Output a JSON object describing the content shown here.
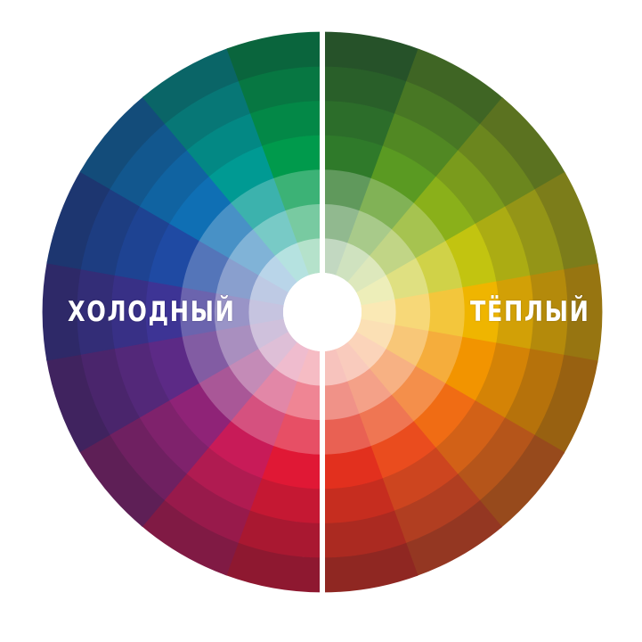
{
  "labels": {
    "cold": "ХОЛОДНЫЙ",
    "warm": "ТЁПЛЫЙ"
  },
  "wheel": {
    "background": "#ffffff",
    "center_color": "#ffffff",
    "divider_color": "#ffffff",
    "sectors": [
      {
        "side": "warm",
        "color": "#2f7a2a"
      },
      {
        "side": "warm",
        "color": "#5a9a22"
      },
      {
        "side": "warm",
        "color": "#8ab01a"
      },
      {
        "side": "warm",
        "color": "#c2c410"
      },
      {
        "side": "warm",
        "color": "#efb500"
      },
      {
        "side": "warm",
        "color": "#f29400"
      },
      {
        "side": "warm",
        "color": "#f06c14"
      },
      {
        "side": "warm",
        "color": "#ea4c1e"
      },
      {
        "side": "warm",
        "color": "#e2301e"
      },
      {
        "side": "cold",
        "color": "#e01835"
      },
      {
        "side": "cold",
        "color": "#c81b58"
      },
      {
        "side": "cold",
        "color": "#8f2377"
      },
      {
        "side": "cold",
        "color": "#5c2a86"
      },
      {
        "side": "cold",
        "color": "#3d3495"
      },
      {
        "side": "cold",
        "color": "#1f4aa3"
      },
      {
        "side": "cold",
        "color": "#0f6fb4"
      },
      {
        "side": "cold",
        "color": "#009a93"
      },
      {
        "side": "cold",
        "color": "#009a4c"
      }
    ]
  }
}
